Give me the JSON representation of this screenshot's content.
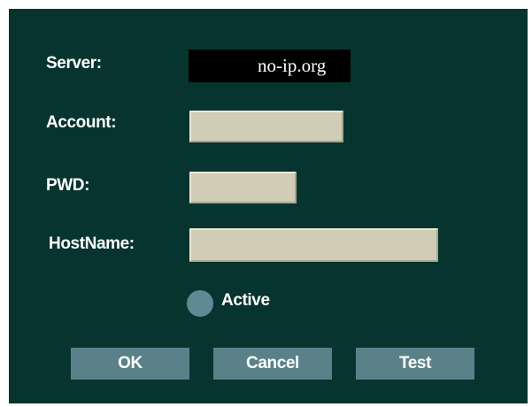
{
  "form": {
    "server_label": "Server:",
    "server_value": "no-ip.org",
    "account_label": "Account:",
    "account_value": "",
    "pwd_label": "PWD:",
    "pwd_value": "",
    "hostname_label": "HostName:",
    "hostname_value": "",
    "active_label": "Active",
    "active_checked": false
  },
  "buttons": {
    "ok": "OK",
    "cancel": "Cancel",
    "test": "Test"
  },
  "colors": {
    "panel_background": "#083430",
    "field_background": "#cfcdb6",
    "button_background": "#5a8189",
    "radio_color": "#5f8a93",
    "server_field_background": "#000000",
    "text": "#ffffff"
  }
}
